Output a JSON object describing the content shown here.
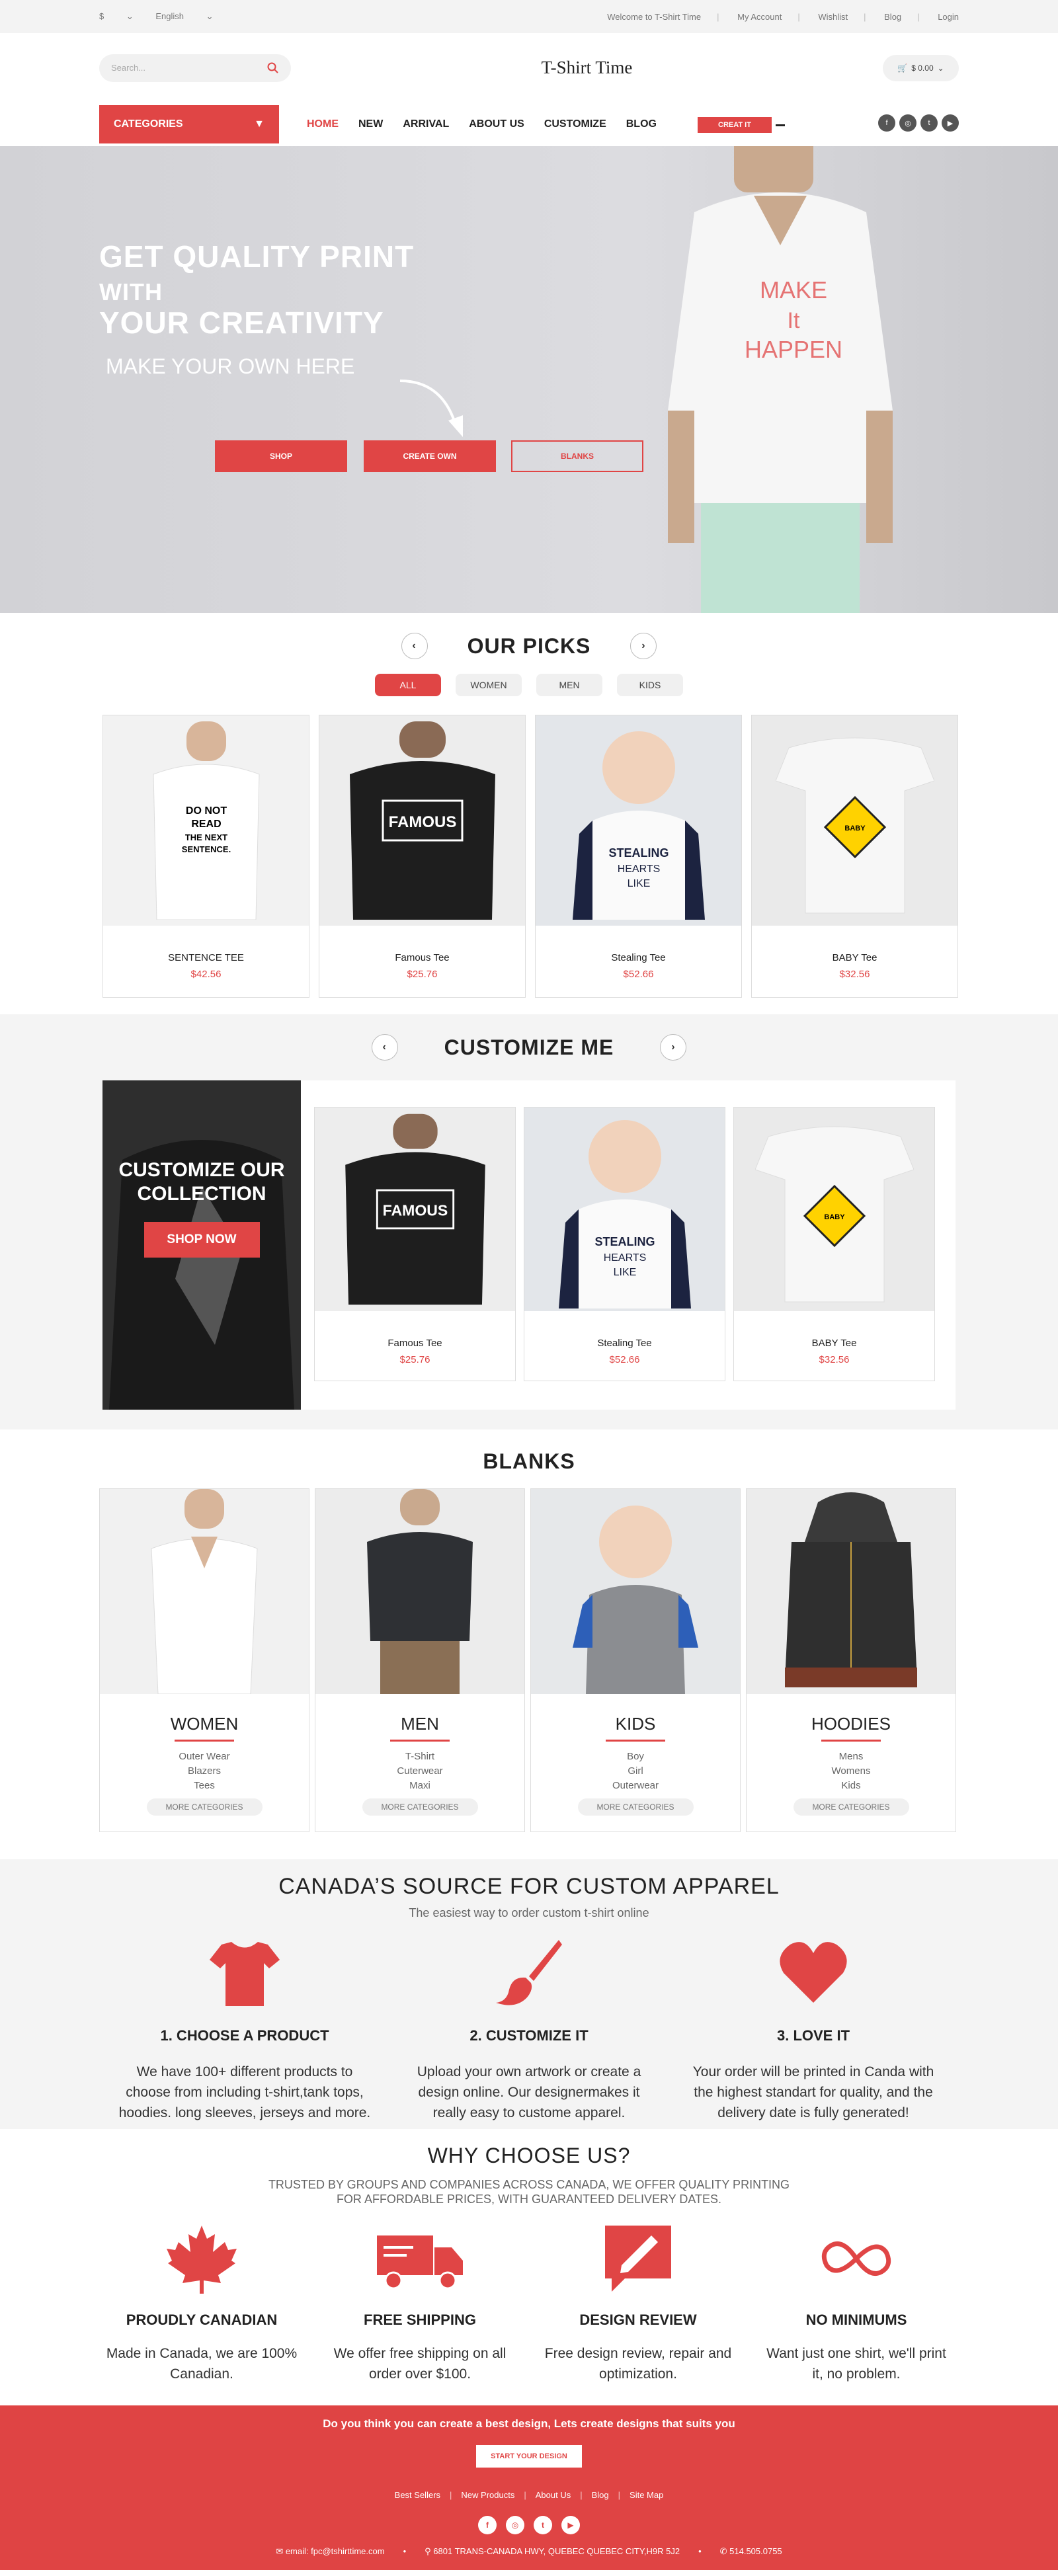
{
  "topbar": {
    "currency": "$",
    "language": "English",
    "welcome": "Welcome to T-Shirt Time",
    "my_account": "My Account",
    "wishlist": "Wishlist",
    "blog": "Blog",
    "login": "Login"
  },
  "header": {
    "search_placeholder": "Search...",
    "logo": "T-Shirt Time",
    "cart_amount": "$ 0.00"
  },
  "nav": {
    "categories": "CATEGORIES",
    "items": [
      "HOME",
      "NEW",
      "ARRIVAL",
      "ABOUT US",
      "CUSTOMIZE",
      "BLOG"
    ],
    "create_it": "CREAT IT"
  },
  "hero": {
    "line1": "GET QUALITY PRINT",
    "line2": "WITH",
    "line3": "YOUR CREATIVITY",
    "sub": "MAKE YOUR OWN HERE",
    "shirt_text": [
      "MAKE",
      "It",
      "HAPPEN"
    ],
    "buttons": [
      "SHOP",
      "CREATE OWN",
      "BLANKS"
    ]
  },
  "picks": {
    "title": "OUR PICKS",
    "filters": [
      "ALL",
      "WOMEN",
      "MEN",
      "KIDS"
    ],
    "products": [
      {
        "name": "SENTENCE TEE",
        "price": "$42.56",
        "print": "DO NOT READ THE NEXT SENTENCE."
      },
      {
        "name": "Famous Tee",
        "price": "$25.76",
        "print": "FAMOUS"
      },
      {
        "name": "Stealing Tee",
        "price": "$52.66",
        "print": "STEALING HEARTS LIKE"
      },
      {
        "name": "BABY Tee",
        "price": "$32.56",
        "print": "BABY ON BOARD"
      }
    ]
  },
  "customize": {
    "title": "CUSTOMIZE ME",
    "promo_title": "CUSTOMIZE OUR COLLECTION",
    "promo_button": "SHOP NOW",
    "products": [
      {
        "name": "Famous Tee",
        "price": "$25.76",
        "print": "FAMOUS"
      },
      {
        "name": "Stealing Tee",
        "price": "$52.66",
        "print": "STEALING HEARTS LIKE"
      },
      {
        "name": "BABY Tee",
        "price": "$32.56",
        "print": "BABY ON BOARD"
      }
    ]
  },
  "blanks": {
    "title": "BLANKS",
    "more": "MORE CATEGORIES",
    "cats": [
      {
        "name": "WOMEN",
        "subs": [
          "Outer Wear",
          "Blazers",
          "Tees"
        ]
      },
      {
        "name": "MEN",
        "subs": [
          "T-Shirt",
          "Cuterwear",
          "Maxi"
        ]
      },
      {
        "name": "KIDS",
        "subs": [
          "Boy",
          "Girl",
          "Outerwear"
        ]
      },
      {
        "name": "HOODIES",
        "subs": [
          "Mens",
          "Womens",
          "Kids"
        ]
      }
    ]
  },
  "canada": {
    "title": "CANADA’S SOURCE FOR CUSTOM APPAREL",
    "tagline": "The easiest way to order custom t-shirt online",
    "steps": [
      {
        "title": "1. CHOOSE A PRODUCT",
        "desc": "We have 100+ different products to choose from including t-shirt,tank tops, hoodies. long sleeves, jerseys and more.",
        "icon": "tshirt-icon"
      },
      {
        "title": "2. CUSTOMIZE IT",
        "desc": "Upload your own artwork or create a design online. Our designermakes it really easy to custome apparel.",
        "icon": "paintbrush-icon"
      },
      {
        "title": "3. LOVE IT",
        "desc": "Your order will be printed in Canda with the highest standart for quality, and the delivery date is fully generated!",
        "icon": "heart-icon"
      }
    ]
  },
  "why": {
    "title": "WHY CHOOSE US?",
    "tagline1": "TRUSTED BY GROUPS AND COMPANIES ACROSS CANADA, WE OFFER QUALITY PRINTING",
    "tagline2": "FOR AFFORDABLE PRICES, WITH GUARANTEED DELIVERY DATES.",
    "items": [
      {
        "title": "PROUDLY CANADIAN",
        "desc": "Made in Canada, we are 100% Canadian."
      },
      {
        "title": "FREE SHIPPING",
        "desc": "We offer free shipping on all order over $100."
      },
      {
        "title": "DESIGN REVIEW",
        "desc": "Free design review, repair and optimization."
      },
      {
        "title": "NO MINIMUMS",
        "desc": "Want just one shirt, we'll print it, no problem."
      }
    ]
  },
  "footer": {
    "lead": "Do you think you can create a best design, Lets create designs that suits you",
    "button": "START YOUR DESIGN",
    "links": [
      "Best Sellers",
      "New Products",
      "About Us",
      "Blog",
      "Site Map"
    ],
    "email": "email: fpc@tshirttime.com",
    "address": "6801 TRANS-CANADA HWY, QUEBEC QUEBEC CITY,H9R 5J2",
    "phone": "514.505.0755"
  },
  "colors": {
    "accent": "#e04545",
    "footer": "#df4444"
  }
}
